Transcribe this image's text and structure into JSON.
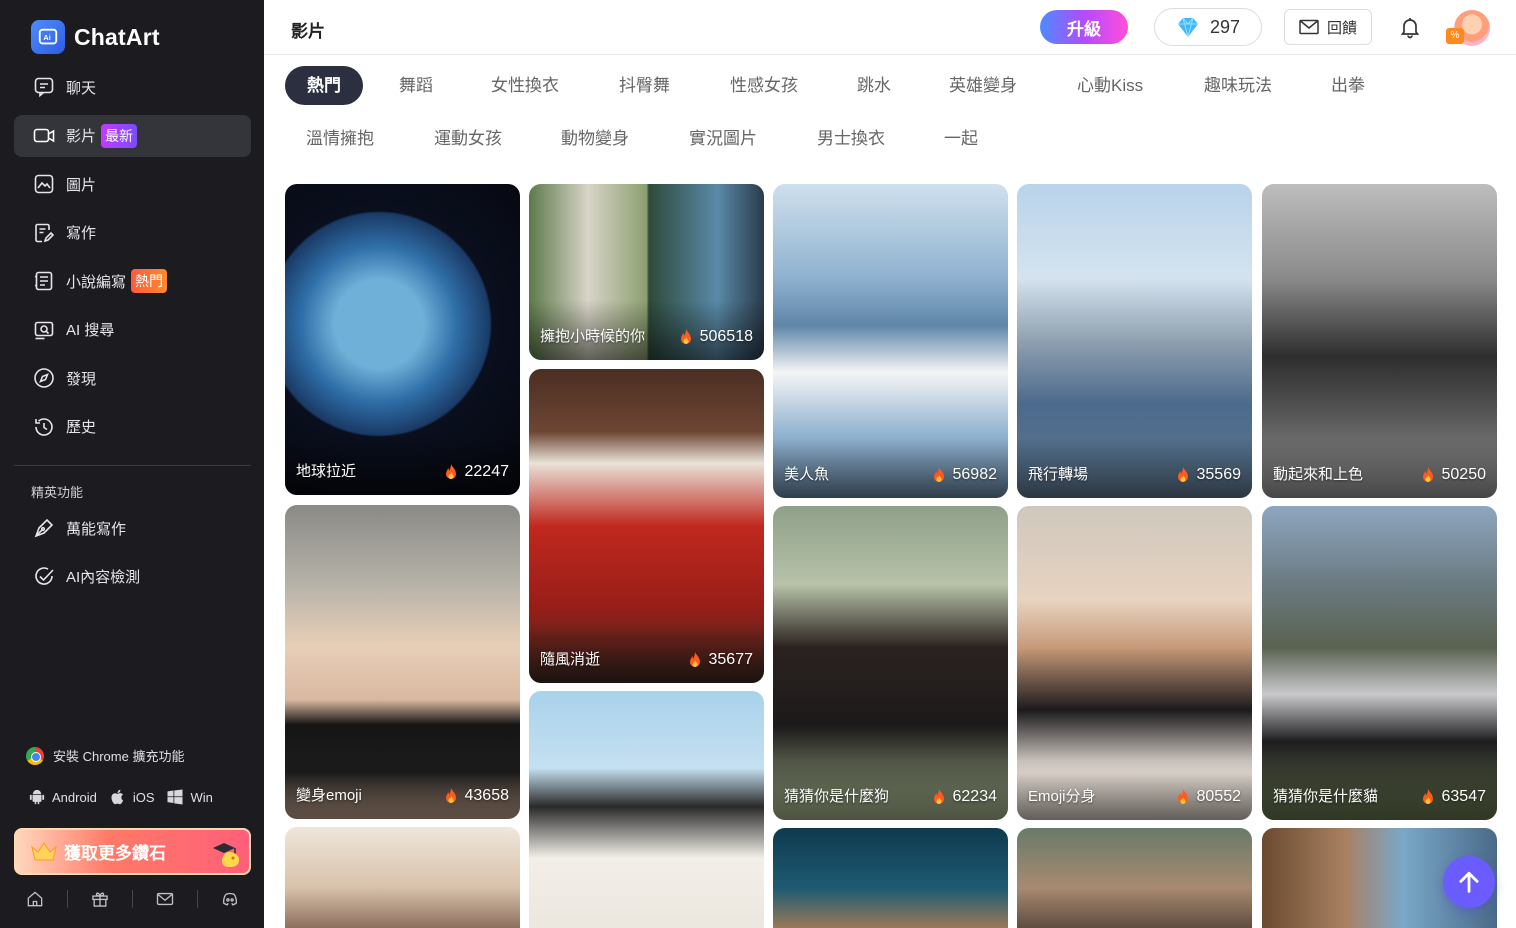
{
  "app": {
    "name": "ChatArt"
  },
  "sidebar": {
    "items": [
      {
        "label": "聊天",
        "icon": "chat-icon",
        "badge": ""
      },
      {
        "label": "影片",
        "icon": "video-icon",
        "badge": "最新",
        "active": true
      },
      {
        "label": "圖片",
        "icon": "image-icon",
        "badge": ""
      },
      {
        "label": "寫作",
        "icon": "writing-icon",
        "badge": ""
      },
      {
        "label": "小說編寫",
        "icon": "novel-icon",
        "badge": "熱門"
      },
      {
        "label": "AI 搜尋",
        "icon": "ai-search-icon",
        "badge": ""
      },
      {
        "label": "發現",
        "icon": "compass-icon",
        "badge": ""
      },
      {
        "label": "歷史",
        "icon": "history-icon",
        "badge": ""
      }
    ],
    "section_title": "精英功能",
    "pro_items": [
      {
        "label": "萬能寫作",
        "icon": "pen-icon"
      },
      {
        "label": "AI內容檢測",
        "icon": "check-icon"
      }
    ],
    "install_text": "安裝 Chrome 擴充功能",
    "platforms": [
      "Android",
      "iOS",
      "Win"
    ],
    "cta": "獲取更多鑽石"
  },
  "header": {
    "title": "影片",
    "upgrade": "升級",
    "gems": "297",
    "feedback": "回饋"
  },
  "tabs": [
    "熱門",
    "舞蹈",
    "女性換衣",
    "抖臀舞",
    "性感女孩",
    "跳水",
    "英雄變身",
    "心動Kiss",
    "趣味玩法",
    "出拳",
    "溫情擁抱",
    "運動女孩",
    "動物變身",
    "實況圖片",
    "男士換衣",
    "一起"
  ],
  "cards": [
    {
      "title": "地球拉近",
      "count": "22247"
    },
    {
      "title": "擁抱小時候的你",
      "count": "506518"
    },
    {
      "title": "美人魚",
      "count": "56982"
    },
    {
      "title": "飛行轉場",
      "count": "35569"
    },
    {
      "title": "動起來和上色",
      "count": "50250"
    },
    {
      "title": "變身emoji",
      "count": "43658"
    },
    {
      "title": "隨風消逝",
      "count": "35677"
    },
    {
      "title": "猜猜你是什麼狗",
      "count": "62234"
    },
    {
      "title": "Emoji分身",
      "count": "80552"
    },
    {
      "title": "猜猜你是什麼貓",
      "count": "63547"
    },
    {
      "title": "",
      "count": ""
    },
    {
      "title": "",
      "count": ""
    },
    {
      "title": "",
      "count": ""
    },
    {
      "title": "",
      "count": ""
    },
    {
      "title": "",
      "count": ""
    }
  ]
}
